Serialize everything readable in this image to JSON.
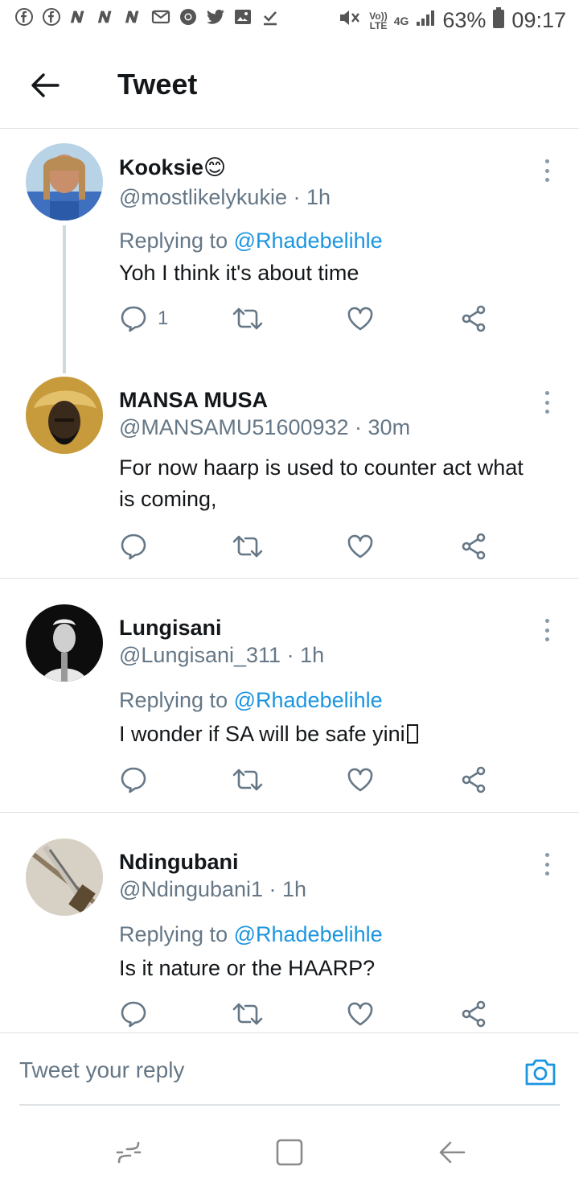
{
  "status_bar": {
    "volte": "Vo))",
    "lte": "LTE",
    "net_type": "4G",
    "battery": "63%",
    "time": "09:17"
  },
  "header": {
    "title": "Tweet"
  },
  "tweets": [
    {
      "name": "Kooksie",
      "emoji": "😊",
      "handle": "@mostlikelykukie",
      "time": " · 1h",
      "replying_prefix": "Replying to ",
      "replying_to": "@Rhadebelihle",
      "text": "Yoh I think it's about time",
      "reply_count": "1"
    },
    {
      "name": "MANSA MUSA",
      "handle": "@MANSAMU51600932",
      "time": " · 30m",
      "text": "For now haarp is used to counter act what is coming,",
      "reply_count": ""
    },
    {
      "name": "Lungisani",
      "handle": "@Lungisani_311",
      "time": " · 1h",
      "replying_prefix": "Replying to ",
      "replying_to": "@Rhadebelihle",
      "text": "I wonder if SA will be safe yini",
      "reply_count": ""
    },
    {
      "name": "Ndingubani",
      "handle": "@Ndingubani1",
      "time": " · 1h",
      "replying_prefix": "Replying to ",
      "replying_to": "@Rhadebelihle",
      "text": "Is it nature or the HAARP?",
      "reply_count": ""
    }
  ],
  "reply_bar": {
    "placeholder": "Tweet your reply"
  },
  "colors": {
    "link_blue": "#1b95e0",
    "muted_gray": "#657786",
    "divider": "#dfe3e6"
  }
}
